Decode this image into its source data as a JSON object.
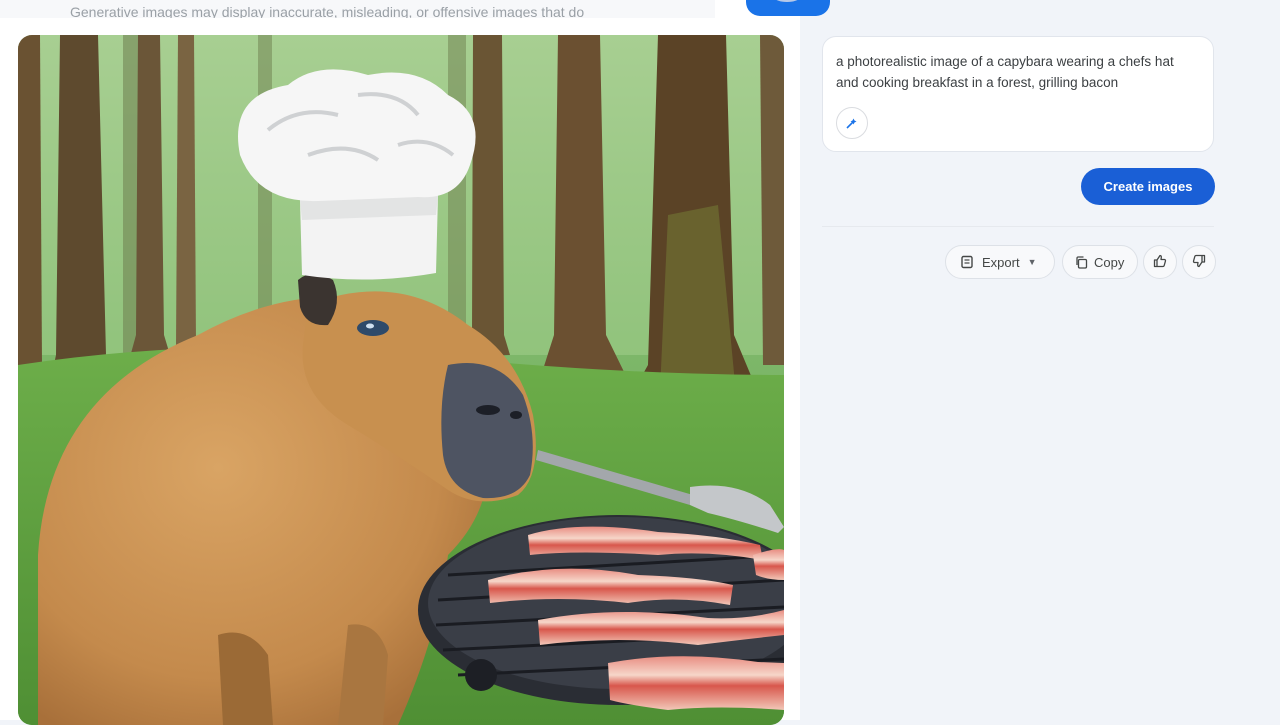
{
  "top_notice": {
    "text": "Generative images may display inaccurate, misleading, or offensive images that do"
  },
  "prompt": {
    "text": "a photorealistic image of a capybara wearing a chefs hat and cooking breakfast in a forest, grilling bacon"
  },
  "icons": {
    "edit": "edit-prompt-icon",
    "export": "export-icon",
    "copy": "copy-icon",
    "thumbs_up": "thumbs-up-icon",
    "thumbs_down": "thumbs-down-icon",
    "caret": "chevron-down-icon"
  },
  "buttons": {
    "create": "Create images",
    "export": "Export",
    "copy": "Copy"
  },
  "colors": {
    "primary": "#1a5fd6",
    "panel_bg": "#f1f4f9"
  }
}
